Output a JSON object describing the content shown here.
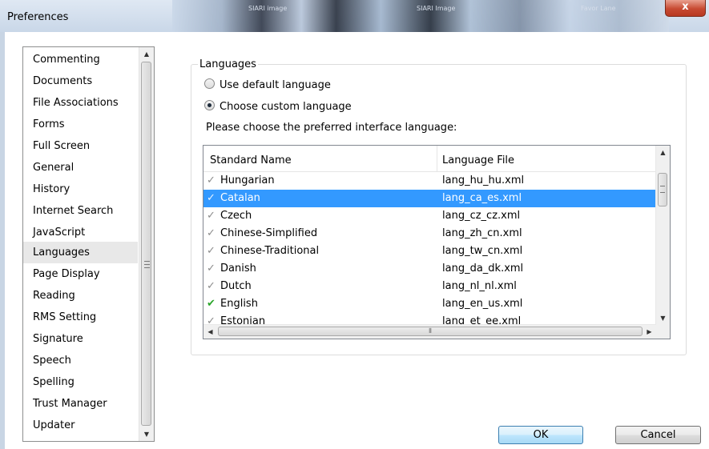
{
  "window": {
    "title": "Preferences",
    "close_label": "x"
  },
  "title_decor": {
    "blur_texts": [
      "SIARI image",
      "SIARI Image",
      "Favor Lane"
    ]
  },
  "sidebar": {
    "items": [
      {
        "label": "Commenting"
      },
      {
        "label": "Documents"
      },
      {
        "label": "File Associations"
      },
      {
        "label": "Forms"
      },
      {
        "label": "Full Screen"
      },
      {
        "label": "General"
      },
      {
        "label": "History"
      },
      {
        "label": "Internet Search"
      },
      {
        "label": "JavaScript"
      },
      {
        "label": "Languages",
        "selected": true
      },
      {
        "label": "Page Display"
      },
      {
        "label": "Reading"
      },
      {
        "label": "RMS Setting"
      },
      {
        "label": "Signature"
      },
      {
        "label": "Speech"
      },
      {
        "label": "Spelling"
      },
      {
        "label": "Trust Manager"
      },
      {
        "label": "Updater"
      }
    ]
  },
  "languages": {
    "group_title": "Languages",
    "option_default": "Use default language",
    "option_custom": "Choose custom language",
    "selected_option": "custom",
    "prompt": "Please choose the preferred interface language:",
    "table": {
      "columns": [
        "Standard Name",
        "Language File"
      ],
      "rows": [
        {
          "name": "Hungarian",
          "file": "lang_hu_hu.xml",
          "check": "gray"
        },
        {
          "name": "Catalan",
          "file": "lang_ca_es.xml",
          "check": "blue",
          "selected": true
        },
        {
          "name": "Czech",
          "file": "lang_cz_cz.xml",
          "check": "gray"
        },
        {
          "name": "Chinese-Simplified",
          "file": "lang_zh_cn.xml",
          "check": "gray"
        },
        {
          "name": "Chinese-Traditional",
          "file": "lang_tw_cn.xml",
          "check": "gray"
        },
        {
          "name": "Danish",
          "file": "lang_da_dk.xml",
          "check": "gray"
        },
        {
          "name": "Dutch",
          "file": "lang_nl_nl.xml",
          "check": "gray"
        },
        {
          "name": "English",
          "file": "lang_en_us.xml",
          "check": "green"
        },
        {
          "name": "Estonian",
          "file": "lang_et_ee.xml",
          "check": "gray"
        }
      ]
    }
  },
  "buttons": {
    "ok": "OK",
    "cancel": "Cancel"
  },
  "colors": {
    "selection": "#3399ff",
    "check_green": "#2aa52a",
    "check_gray": "#8c8c8c"
  }
}
